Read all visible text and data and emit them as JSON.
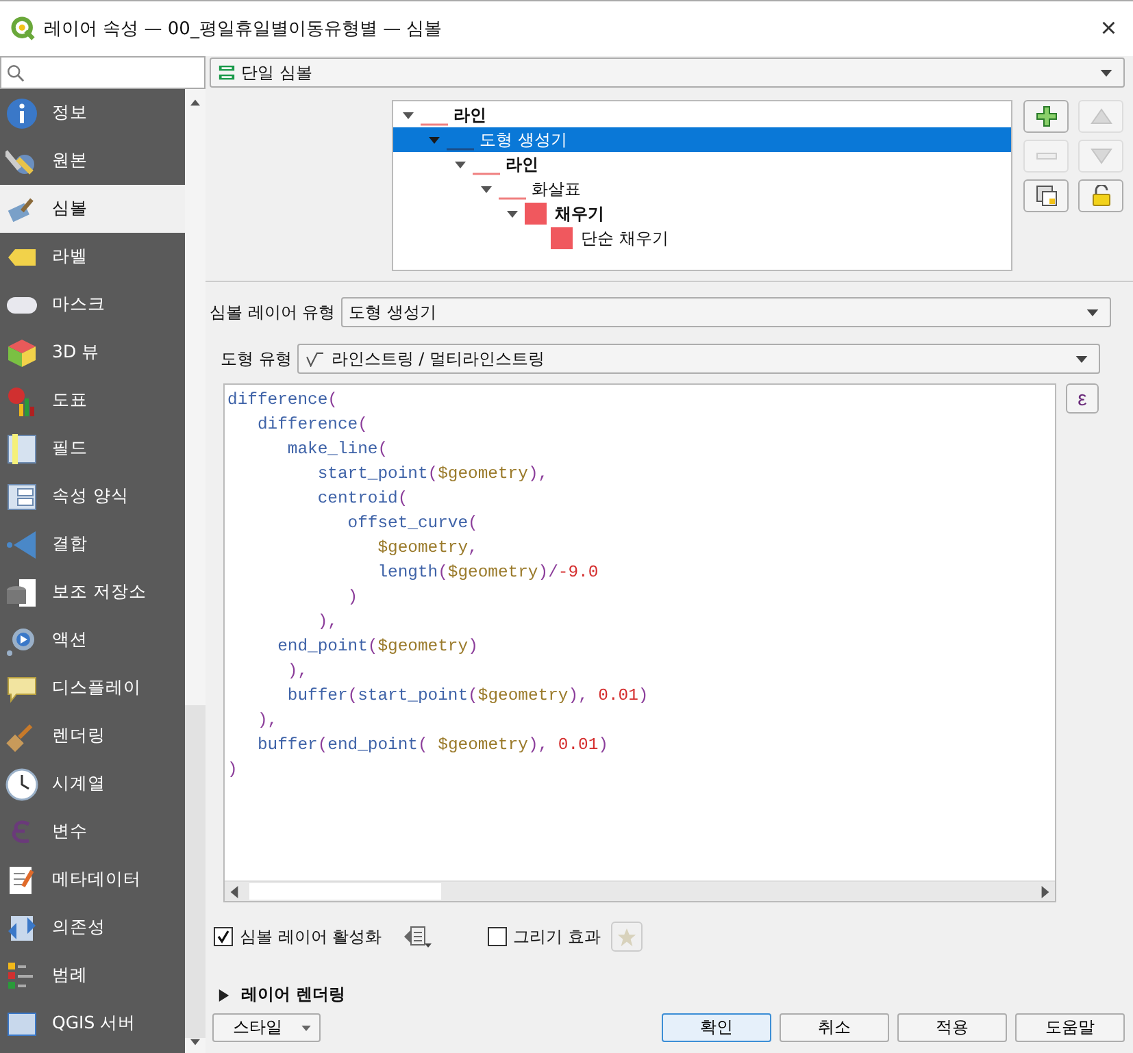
{
  "window": {
    "title": "레이어 속성 — 00_평일휴일별이동유형별 — 심볼",
    "close": "×"
  },
  "sidebar": {
    "items": [
      {
        "label": "정보",
        "selected": false
      },
      {
        "label": "원본",
        "selected": false
      },
      {
        "label": "심볼",
        "selected": true
      },
      {
        "label": "라벨",
        "selected": false
      },
      {
        "label": "마스크",
        "selected": false
      },
      {
        "label": "3D 뷰",
        "selected": false
      },
      {
        "label": "도표",
        "selected": false
      },
      {
        "label": "필드",
        "selected": false
      },
      {
        "label": "속성 양식",
        "selected": false
      },
      {
        "label": "결합",
        "selected": false
      },
      {
        "label": "보조 저장소",
        "selected": false
      },
      {
        "label": "액션",
        "selected": false
      },
      {
        "label": "디스플레이",
        "selected": false
      },
      {
        "label": "렌더링",
        "selected": false
      },
      {
        "label": "시계열",
        "selected": false
      },
      {
        "label": "변수",
        "selected": false
      },
      {
        "label": "메타데이터",
        "selected": false
      },
      {
        "label": "의존성",
        "selected": false
      },
      {
        "label": "범례",
        "selected": false
      },
      {
        "label": "QGIS 서버",
        "selected": false
      }
    ]
  },
  "renderer": {
    "value": "단일 심볼"
  },
  "symbol_tree": [
    {
      "label": "라인",
      "kind": "line",
      "bold": true,
      "selected": false,
      "expanded": true,
      "children": [
        {
          "label": "도형 생성기",
          "kind": "line",
          "bold": false,
          "selected": true,
          "expanded": true,
          "children": [
            {
              "label": "라인",
              "kind": "line",
              "bold": true,
              "selected": false,
              "expanded": true,
              "children": [
                {
                  "label": "화살표",
                  "kind": "line",
                  "bold": false,
                  "selected": false,
                  "expanded": true,
                  "children": [
                    {
                      "label": "채우기",
                      "kind": "fill",
                      "bold": true,
                      "selected": false,
                      "expanded": true,
                      "children": [
                        {
                          "label": "단순 채우기",
                          "kind": "fill",
                          "bold": false,
                          "selected": false
                        }
                      ]
                    }
                  ]
                }
              ]
            }
          ]
        }
      ]
    }
  ],
  "symbol_layer_type": {
    "label": "심볼 레이어 유형",
    "value": "도형 생성기"
  },
  "geometry_type": {
    "label": "도형 유형",
    "value": "라인스트링 / 멀티라인스트링"
  },
  "expression": [
    [
      {
        "kind": "func",
        "text": "difference"
      },
      {
        "kind": "punct",
        "text": "("
      }
    ],
    [
      {
        "kind": "func",
        "text": "   difference"
      },
      {
        "kind": "punct",
        "text": "("
      }
    ],
    [
      {
        "kind": "func",
        "text": "      make_line"
      },
      {
        "kind": "punct",
        "text": "("
      }
    ],
    [
      {
        "kind": "func",
        "text": "         start_point"
      },
      {
        "kind": "punct",
        "text": "("
      },
      {
        "kind": "var",
        "text": "$geometry"
      },
      {
        "kind": "punct",
        "text": "),"
      }
    ],
    [
      {
        "kind": "func",
        "text": "         centroid"
      },
      {
        "kind": "punct",
        "text": "("
      }
    ],
    [
      {
        "kind": "func",
        "text": "            offset_curve"
      },
      {
        "kind": "punct",
        "text": "("
      }
    ],
    [
      {
        "kind": "var",
        "text": "               $geometry"
      },
      {
        "kind": "punct",
        "text": ","
      }
    ],
    [
      {
        "kind": "func",
        "text": "               length"
      },
      {
        "kind": "punct",
        "text": "("
      },
      {
        "kind": "var",
        "text": "$geometry"
      },
      {
        "kind": "punct",
        "text": ")/"
      },
      {
        "kind": "number",
        "text": "-9.0"
      }
    ],
    [
      {
        "kind": "punct",
        "text": "            )"
      }
    ],
    [
      {
        "kind": "punct",
        "text": "         ),"
      }
    ],
    [
      {
        "kind": "func",
        "text": "     end_point"
      },
      {
        "kind": "punct",
        "text": "("
      },
      {
        "kind": "var",
        "text": "$geometry"
      },
      {
        "kind": "punct",
        "text": ")"
      }
    ],
    [
      {
        "kind": "punct",
        "text": "      ),"
      }
    ],
    [
      {
        "kind": "func",
        "text": "      buffer"
      },
      {
        "kind": "punct",
        "text": "("
      },
      {
        "kind": "func",
        "text": "start_point"
      },
      {
        "kind": "punct",
        "text": "("
      },
      {
        "kind": "var",
        "text": "$geometry"
      },
      {
        "kind": "punct",
        "text": "), "
      },
      {
        "kind": "number",
        "text": "0.01"
      },
      {
        "kind": "punct",
        "text": ")"
      }
    ],
    [
      {
        "kind": "punct",
        "text": "   ),"
      }
    ],
    [
      {
        "kind": "func",
        "text": "   buffer"
      },
      {
        "kind": "punct",
        "text": "("
      },
      {
        "kind": "func",
        "text": "end_point"
      },
      {
        "kind": "punct",
        "text": "( "
      },
      {
        "kind": "var",
        "text": "$geometry"
      },
      {
        "kind": "punct",
        "text": "), "
      },
      {
        "kind": "number",
        "text": "0.01"
      },
      {
        "kind": "punct",
        "text": ")"
      }
    ],
    [
      {
        "kind": "punct",
        "text": ")"
      }
    ]
  ],
  "expression_button": "ε",
  "enable_symbol_layer": {
    "label": "심볼 레이어 활성화",
    "checked": true
  },
  "draw_effects": {
    "label": "그리기 효과",
    "checked": false
  },
  "layer_rendering": {
    "label": "레이어 렌더링",
    "expanded": false
  },
  "style_button": "스타일",
  "buttons": [
    {
      "label": "확인",
      "default": true
    },
    {
      "label": "취소",
      "default": false
    },
    {
      "label": "적용",
      "default": false
    },
    {
      "label": "도움말",
      "default": false
    }
  ]
}
